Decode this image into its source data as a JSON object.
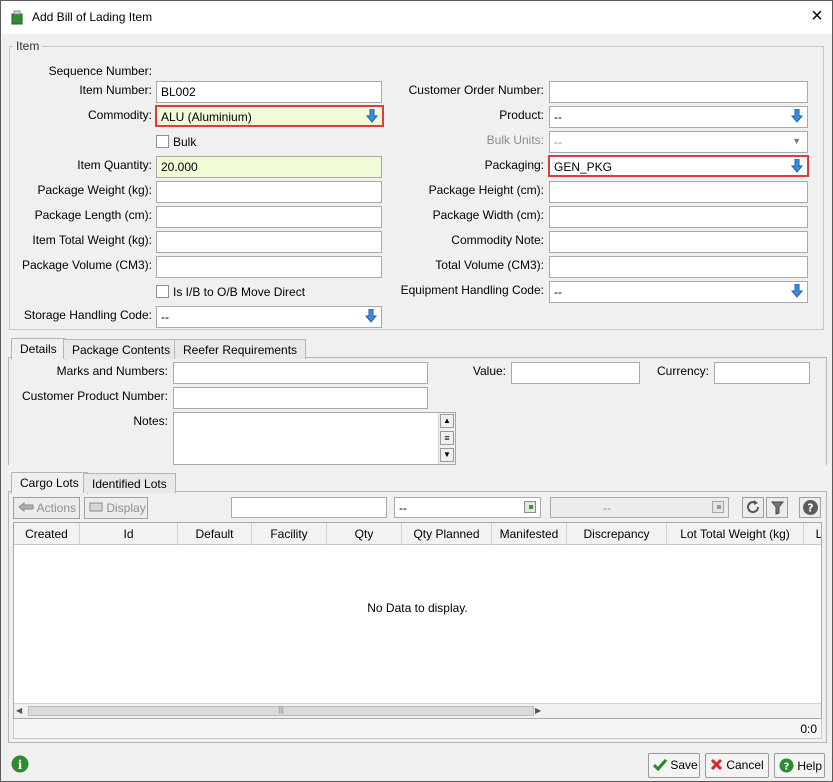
{
  "window": {
    "title": "Add Bill of Lading Item"
  },
  "item_group": {
    "title": "Item",
    "sequence_number_label": "Sequence Number:",
    "item_number_label": "Item Number:",
    "item_number_value": "BL002",
    "commodity_label": "Commodity:",
    "commodity_value": "ALU (Aluminium)",
    "bulk_label": "Bulk",
    "item_quantity_label": "Item Quantity:",
    "item_quantity_value": "20.000",
    "package_weight_label": "Package Weight (kg):",
    "package_length_label": "Package Length (cm):",
    "item_total_weight_label": "Item Total Weight (kg):",
    "package_volume_label": "Package Volume (CM3):",
    "move_direct_label": "Is I/B to O/B Move Direct",
    "storage_handling_label": "Storage Handling Code:",
    "storage_handling_value": "--",
    "customer_order_label": "Customer Order Number:",
    "product_label": "Product:",
    "product_value": "--",
    "bulk_units_label": "Bulk Units:",
    "bulk_units_value": "--",
    "packaging_label": "Packaging:",
    "packaging_value": "GEN_PKG",
    "package_height_label": "Package Height (cm):",
    "package_width_label": "Package Width (cm):",
    "commodity_note_label": "Commodity Note:",
    "total_volume_label": "Total Volume (CM3):",
    "equipment_handling_label": "Equipment Handling Code:",
    "equipment_handling_value": "--"
  },
  "detail_tabs": [
    "Details",
    "Package Contents",
    "Reefer Requirements"
  ],
  "details": {
    "marks_label": "Marks and Numbers:",
    "customer_product_label": "Customer Product Number:",
    "notes_label": "Notes:",
    "value_label": "Value:",
    "currency_label": "Currency:"
  },
  "lot_tabs": [
    "Cargo Lots",
    "Identified Lots"
  ],
  "lots_toolbar": {
    "actions_label": "Actions",
    "display_label": "Display",
    "filter_value_1": "--",
    "filter_value_2": "--"
  },
  "lots_table": {
    "columns": [
      "Created",
      "Id",
      "Default",
      "Facility",
      "Qty",
      "Qty Planned",
      "Manifested",
      "Discrepancy",
      "Lot Total Weight (kg)",
      "Lot"
    ],
    "empty_message": "No Data to display.",
    "count": "0:0"
  },
  "footer": {
    "save_label": "Save",
    "cancel_label": "Cancel",
    "help_label": "Help"
  }
}
